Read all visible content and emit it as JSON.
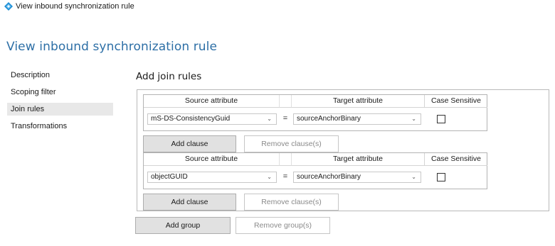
{
  "window": {
    "title": "View inbound synchronization rule",
    "icon": "sync-rule-diamond-icon",
    "icon_color": "#1e8fd6"
  },
  "page": {
    "title": "View inbound synchronization rule"
  },
  "nav": {
    "items": [
      {
        "label": "Description",
        "selected": false
      },
      {
        "label": "Scoping filter",
        "selected": false
      },
      {
        "label": "Join rules",
        "selected": true
      },
      {
        "label": "Transformations",
        "selected": false
      }
    ]
  },
  "section": {
    "title": "Add join rules"
  },
  "join_groups": [
    {
      "headers": {
        "source": "Source attribute",
        "target": "Target attribute",
        "case_sensitive": "Case Sensitive"
      },
      "source_value": "mS-DS-ConsistencyGuid",
      "operator": "=",
      "target_value": "sourceAnchorBinary",
      "case_sensitive_checked": false,
      "add_clause_label": "Add clause",
      "remove_clause_label": "Remove clause(s)"
    },
    {
      "headers": {
        "source": "Source attribute",
        "target": "Target attribute",
        "case_sensitive": "Case Sensitive"
      },
      "source_value": "objectGUID",
      "operator": "=",
      "target_value": "sourceAnchorBinary",
      "case_sensitive_checked": false,
      "add_clause_label": "Add clause",
      "remove_clause_label": "Remove clause(s)"
    }
  ],
  "footer": {
    "add_group_label": "Add group",
    "remove_group_label": "Remove group(s)"
  },
  "colors": {
    "title_blue": "#2d6fa6",
    "selected_nav_bg": "#e8e8e8",
    "button_bg": "#e1e1e1"
  }
}
